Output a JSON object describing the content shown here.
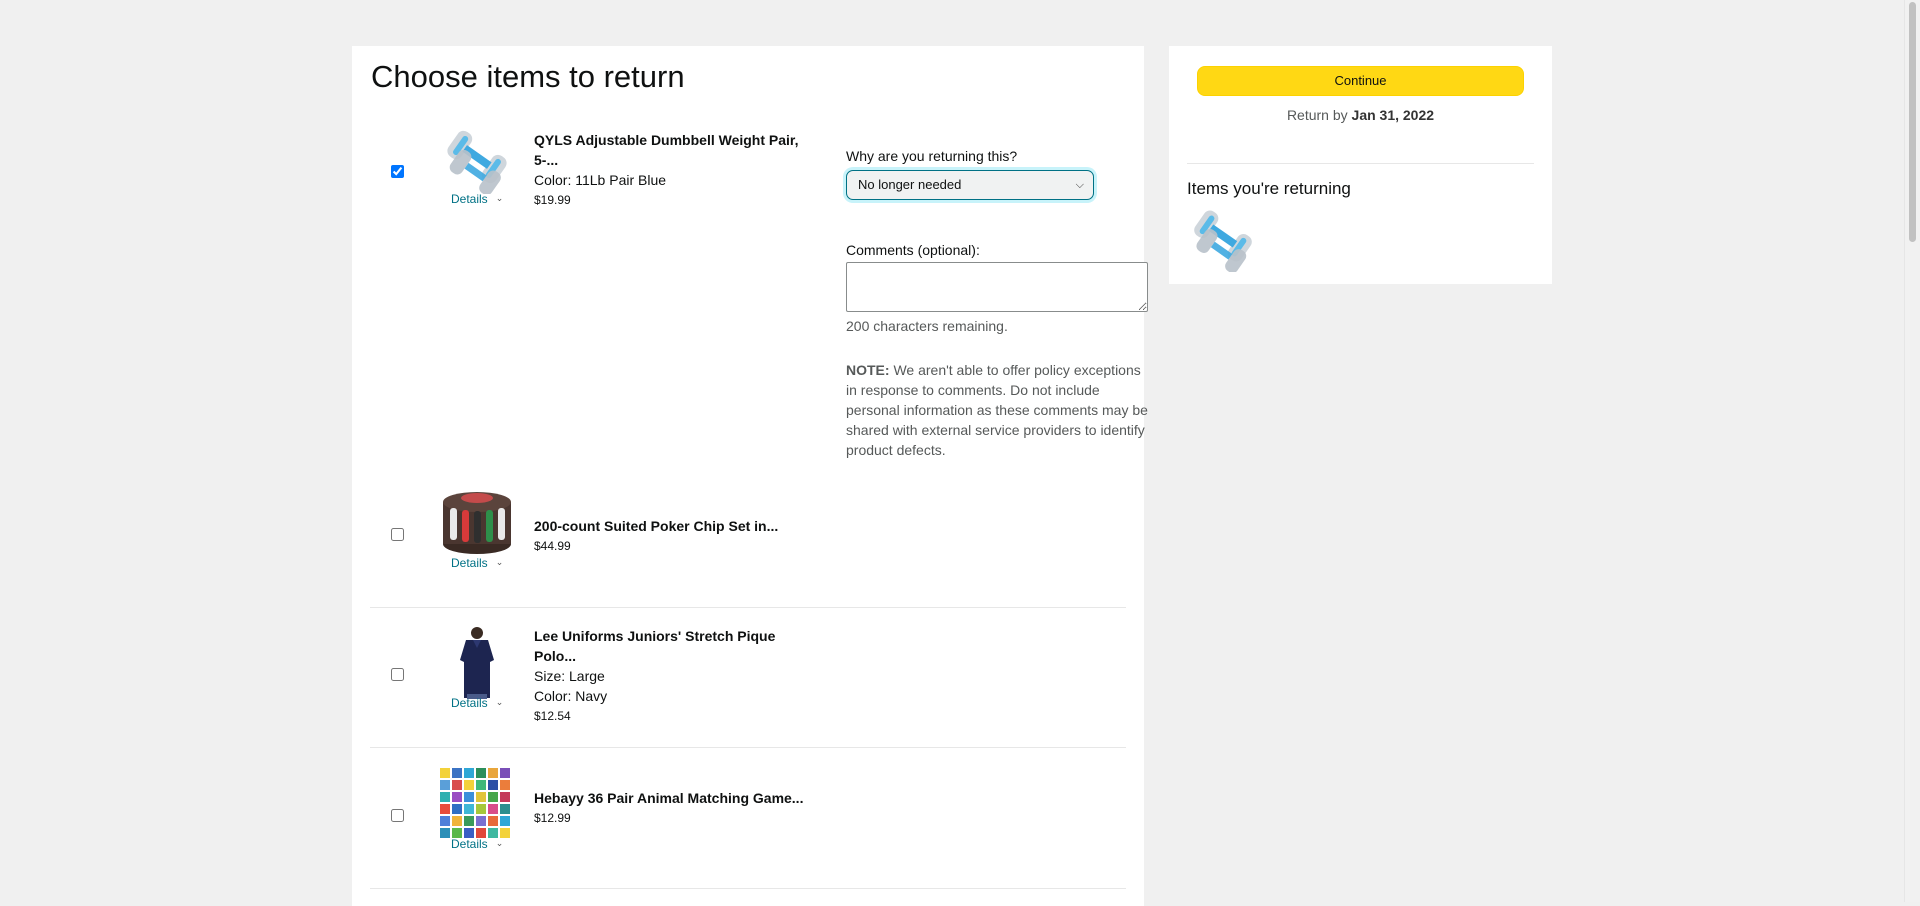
{
  "page": {
    "title": "Choose items to return"
  },
  "items": [
    {
      "name": "QYLS Adjustable Dumbbell Weight Pair, 5-...",
      "attributes": [
        "Color: 11Lb Pair Blue"
      ],
      "price": "$19.99",
      "checked": true,
      "details_label": "Details",
      "image_icon": "dumbbell-icon"
    },
    {
      "name": "200-count Suited Poker Chip Set in...",
      "attributes": [],
      "price": "$44.99",
      "checked": false,
      "details_label": "Details",
      "image_icon": "poker-chips-icon"
    },
    {
      "name": "Lee Uniforms Juniors' Stretch Pique Polo...",
      "attributes": [
        "Size: Large",
        "Color: Navy"
      ],
      "price": "$12.54",
      "checked": false,
      "details_label": "Details",
      "image_icon": "polo-shirt-icon"
    },
    {
      "name": "Hebayy 36 Pair Animal Matching Game...",
      "attributes": [],
      "price": "$12.99",
      "checked": false,
      "details_label": "Details",
      "image_icon": "matching-game-icon"
    }
  ],
  "return_form": {
    "reason_label": "Why are you returning this?",
    "reason_value": "No longer needed",
    "comments_label": "Comments (optional):",
    "comments_value": "",
    "remaining_text": "200 characters remaining.",
    "note_label": "NOTE:",
    "note_text": " We aren't able to offer policy exceptions in response to comments. Do not include personal information as these comments may be shared with external service providers to identify product defects."
  },
  "sidebar": {
    "continue_label": "Continue",
    "return_by_prefix": "Return by ",
    "return_by_date": "Jan 31, 2022",
    "items_heading": "Items you're returning"
  },
  "colors": {
    "continue_button": "#ffd814",
    "link": "#007185",
    "select_focus": "#c8f3fa"
  }
}
